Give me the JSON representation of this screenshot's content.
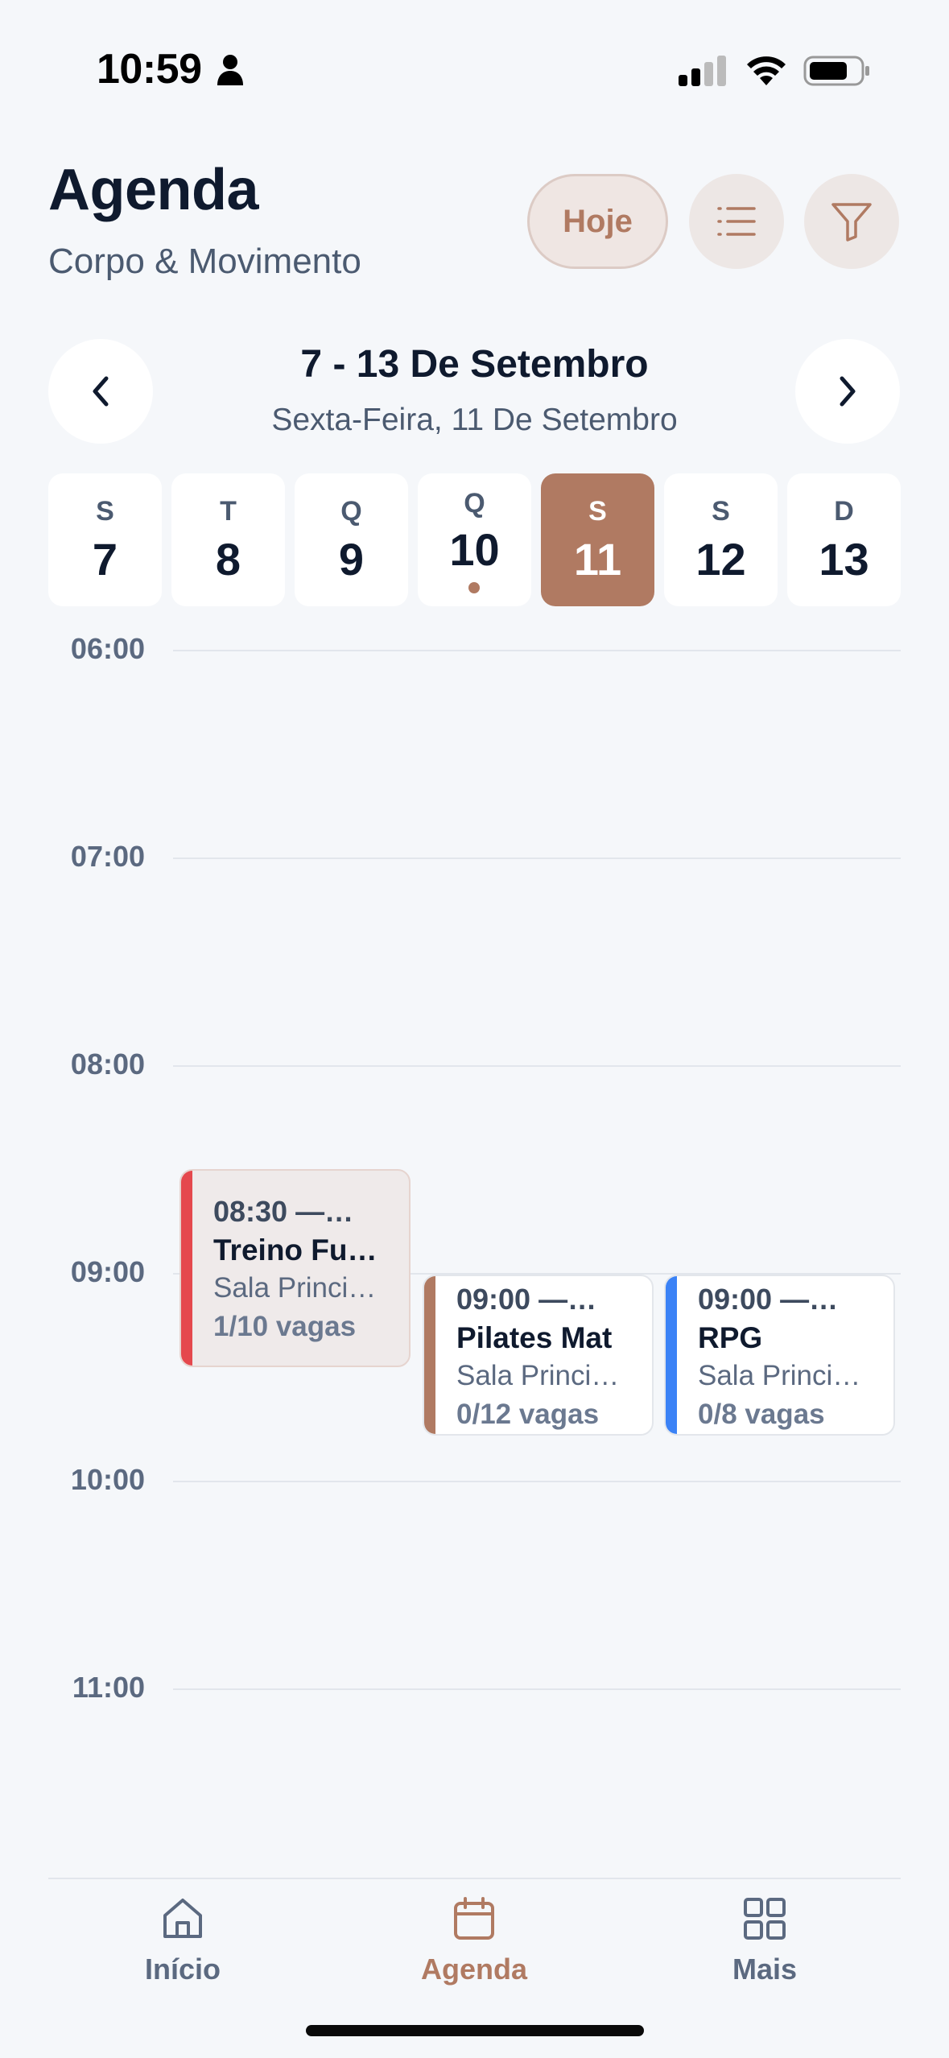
{
  "status_bar": {
    "time": "10:59"
  },
  "header": {
    "title": "Agenda",
    "subtitle": "Corpo & Movimento",
    "today_button": "Hoje"
  },
  "week": {
    "range": "7 - 13 De Setembro",
    "selected_date": "Sexta-Feira, 11 De Setembro"
  },
  "days": [
    {
      "letter": "S",
      "number": "7",
      "selected": false,
      "has_events": false
    },
    {
      "letter": "T",
      "number": "8",
      "selected": false,
      "has_events": false
    },
    {
      "letter": "Q",
      "number": "9",
      "selected": false,
      "has_events": false
    },
    {
      "letter": "Q",
      "number": "10",
      "selected": false,
      "has_events": true
    },
    {
      "letter": "S",
      "number": "11",
      "selected": true,
      "has_events": false
    },
    {
      "letter": "S",
      "number": "12",
      "selected": false,
      "has_events": false
    },
    {
      "letter": "D",
      "number": "13",
      "selected": false,
      "has_events": false
    }
  ],
  "timeline": {
    "hours": [
      "06:00",
      "07:00",
      "08:00",
      "09:00",
      "10:00",
      "11:00"
    ]
  },
  "events": [
    {
      "time": "08:30 —…",
      "title": "Treino Fu…",
      "room": "Sala Princi…",
      "spots": "1/10 vagas",
      "accent": "#e5484d"
    },
    {
      "time": "09:00 —…",
      "title": "Pilates Mat",
      "room": "Sala Princi…",
      "spots": "0/12 vagas",
      "accent": "#b07a62"
    },
    {
      "time": "09:00 —…",
      "title": "RPG",
      "room": "Sala Princi…",
      "spots": "0/8 vagas",
      "accent": "#3b82f6"
    }
  ],
  "tabs": [
    {
      "label": "Início",
      "icon": "home-icon",
      "active": false
    },
    {
      "label": "Agenda",
      "icon": "calendar-icon",
      "active": true
    },
    {
      "label": "Mais",
      "icon": "grid-icon",
      "active": false
    }
  ],
  "colors": {
    "accent": "#b07a62",
    "background": "#f5f7fa",
    "text_primary": "#0f1a2e",
    "text_secondary": "#4b5a70"
  }
}
